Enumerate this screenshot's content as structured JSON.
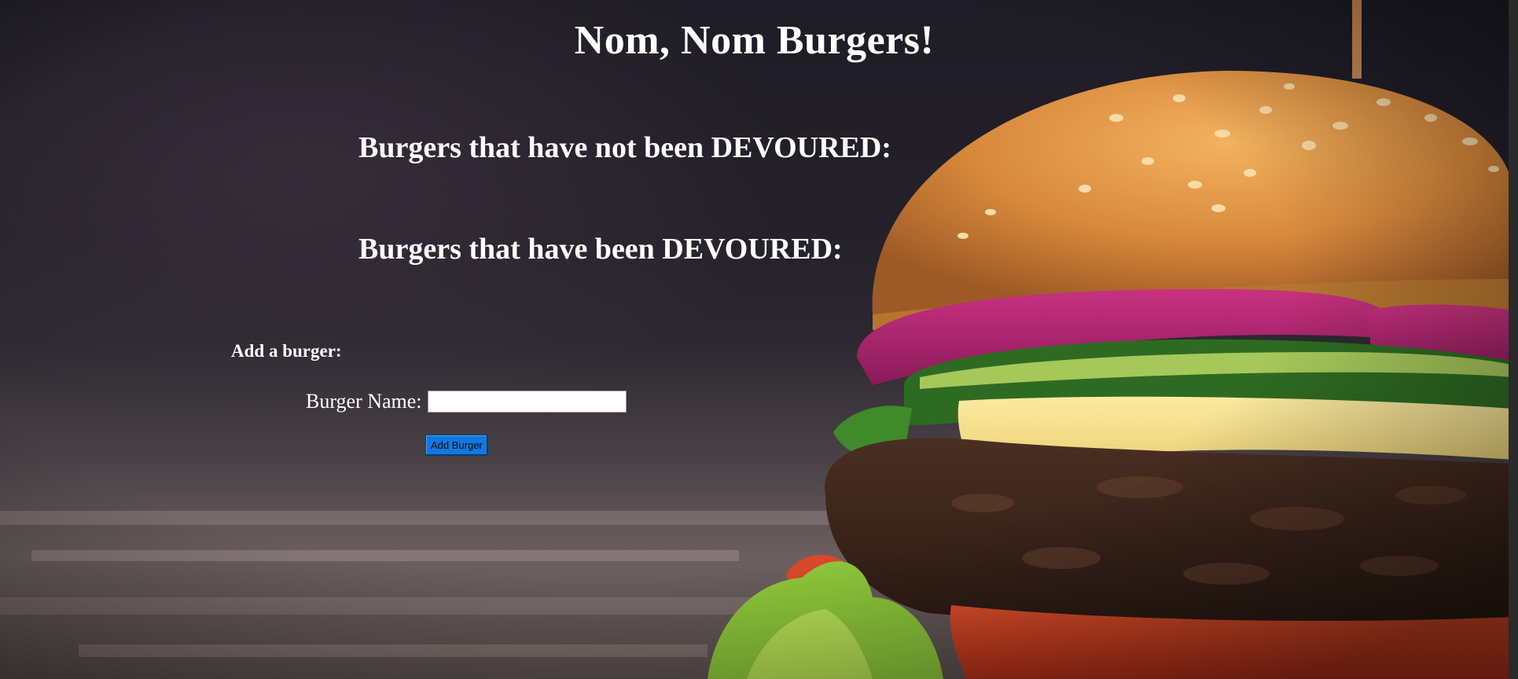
{
  "page": {
    "title": "Nom, Nom Burgers!"
  },
  "sections": {
    "not_devoured_heading": "Burgers that have not been DEVOURED:",
    "devoured_heading": "Burgers that have been DEVOURED:"
  },
  "form": {
    "heading": "Add a burger:",
    "name_label": "Burger Name:",
    "name_value": "",
    "submit_label": "Add Burger"
  },
  "colors": {
    "text": "#ffffff",
    "button_bg": "#1278e0"
  }
}
